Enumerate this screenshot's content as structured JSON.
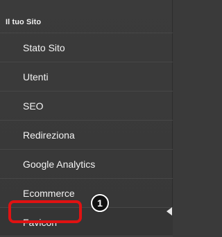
{
  "sidebar": {
    "section_title": "Il tuo Sito",
    "items": [
      {
        "label": "Stato Sito"
      },
      {
        "label": "Utenti"
      },
      {
        "label": "SEO"
      },
      {
        "label": "Redireziona"
      },
      {
        "label": "Google Analytics"
      },
      {
        "label": "Ecommerce"
      },
      {
        "label": "Favicon"
      }
    ],
    "selected_item": "Favicon"
  },
  "annotation": {
    "step_number": "1",
    "highlight_color": "#e01212"
  },
  "colors": {
    "background": "#3a3a3a",
    "text": "#f3f3f3",
    "divider": "#474747"
  }
}
